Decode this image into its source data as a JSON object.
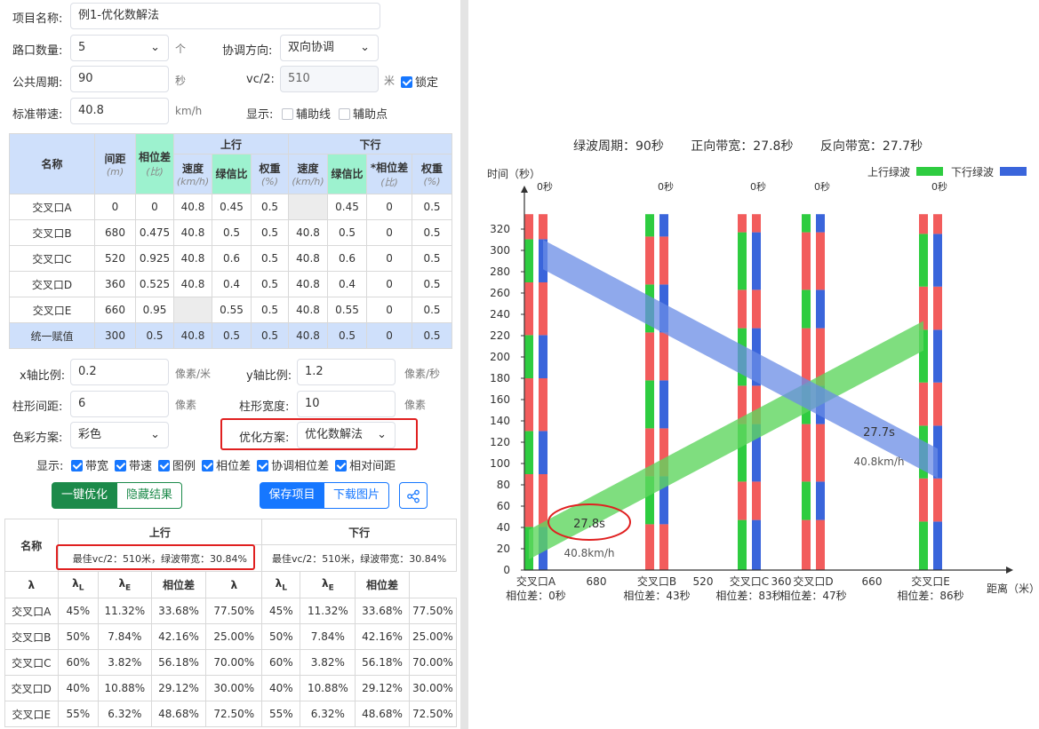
{
  "form": {
    "project_name_label": "项目名称:",
    "project_name": "例1-优化数解法",
    "intersections_label": "路口数量:",
    "intersections": "5",
    "intersections_unit": "个",
    "coord_dir_label": "协调方向:",
    "coord_dir": "双向协调",
    "cycle_label": "公共周期:",
    "cycle": "90",
    "cycle_unit": "秒",
    "vc2_label": "vc/2:",
    "vc2": "510",
    "vc2_unit": "米",
    "lock_label": "锁定",
    "speed_label": "标准带速:",
    "speed": "40.8",
    "speed_unit": "km/h",
    "display_label": "显示:",
    "aux_line": "辅助线",
    "aux_point": "辅助点"
  },
  "table1": {
    "h_name": "名称",
    "h_spacing": "间距",
    "h_spacing_unit": "(m)",
    "h_offset": "相位差",
    "h_offset_unit": "(比)",
    "h_up": "上行",
    "h_down": "下行",
    "h_speed": "速度",
    "h_speed_unit": "(km/h)",
    "h_green": "绿信比",
    "h_weight": "权重",
    "h_weight_unit": "(%)",
    "h_down_offset": "*相位差",
    "rows": [
      [
        "交叉口A",
        "0",
        "0",
        "40.8",
        "0.45",
        "0.5",
        "",
        "0.45",
        "0",
        "0.5"
      ],
      [
        "交叉口B",
        "680",
        "0.475",
        "40.8",
        "0.5",
        "0.5",
        "40.8",
        "0.5",
        "0",
        "0.5"
      ],
      [
        "交叉口C",
        "520",
        "0.925",
        "40.8",
        "0.6",
        "0.5",
        "40.8",
        "0.6",
        "0",
        "0.5"
      ],
      [
        "交叉口D",
        "360",
        "0.525",
        "40.8",
        "0.4",
        "0.5",
        "40.8",
        "0.4",
        "0",
        "0.5"
      ],
      [
        "交叉口E",
        "660",
        "0.95",
        "",
        "0.55",
        "0.5",
        "40.8",
        "0.55",
        "0",
        "0.5"
      ],
      [
        "统一赋值",
        "300",
        "0.5",
        "40.8",
        "0.5",
        "0.5",
        "40.8",
        "0.5",
        "0",
        "0.5"
      ]
    ]
  },
  "settings": {
    "xscale_label": "x轴比例:",
    "xscale": "0.2",
    "xscale_unit": "像素/米",
    "yscale_label": "y轴比例:",
    "yscale": "1.2",
    "yscale_unit": "像素/秒",
    "bar_gap_label": "柱形间距:",
    "bar_gap": "6",
    "bar_gap_unit": "像素",
    "bar_width_label": "柱形宽度:",
    "bar_width": "10",
    "bar_width_unit": "像素",
    "color_label": "色彩方案:",
    "color": "彩色",
    "opt_label": "优化方案:",
    "opt": "优化数解法",
    "show_label": "显示:",
    "show_opts": [
      "带宽",
      "带速",
      "图例",
      "相位差",
      "协调相位差",
      "相对间距"
    ]
  },
  "buttons": {
    "optimize": "一键优化",
    "hide": "隐藏结果",
    "save": "保存项目",
    "download": "下载图片"
  },
  "table2": {
    "h_name": "名称",
    "h_up": "上行",
    "h_down": "下行",
    "up_best": "最佳vc/2：510米，绿波带宽：30.84%",
    "down_best": "最佳vc/2：510米，绿波带宽：30.84%",
    "cols": [
      "λ",
      "λL",
      "λE",
      "相位差",
      "λ",
      "λL",
      "λE",
      "相位差"
    ],
    "rows": [
      [
        "交叉口A",
        "45%",
        "11.32%",
        "33.68%",
        "77.50%",
        "45%",
        "11.32%",
        "33.68%",
        "77.50%"
      ],
      [
        "交叉口B",
        "50%",
        "7.84%",
        "42.16%",
        "25.00%",
        "50%",
        "7.84%",
        "42.16%",
        "25.00%"
      ],
      [
        "交叉口C",
        "60%",
        "3.82%",
        "56.18%",
        "70.00%",
        "60%",
        "3.82%",
        "56.18%",
        "70.00%"
      ],
      [
        "交叉口D",
        "40%",
        "10.88%",
        "29.12%",
        "30.00%",
        "40%",
        "10.88%",
        "29.12%",
        "30.00%"
      ],
      [
        "交叉口E",
        "55%",
        "6.32%",
        "48.68%",
        "72.50%",
        "55%",
        "6.32%",
        "48.68%",
        "72.50%"
      ]
    ]
  },
  "chart": {
    "summary": [
      "绿波周期：90秒",
      "正向带宽：27.8秒",
      "反向带宽：27.7秒"
    ],
    "ylabel": "时间（秒）",
    "xlabel": "距离（米）",
    "legend_up": "上行绿波",
    "legend_down": "下行绿波",
    "colors": {
      "green": "#2ecc40",
      "red": "#f25c5c",
      "blue": "#3a65db",
      "band_up": "#5fd65f",
      "band_down": "#6a8ce6"
    },
    "up_band_label": "27.8s",
    "up_speed_label": "40.8km/h",
    "down_band_label": "27.7s",
    "down_speed_label": "40.8km/h"
  },
  "chart_data": {
    "type": "time-space diagram",
    "cycle": 90,
    "ylim": [
      0,
      330
    ],
    "yticks": [
      0,
      20,
      40,
      60,
      80,
      100,
      120,
      140,
      160,
      180,
      200,
      220,
      240,
      260,
      280,
      300,
      320
    ],
    "intersections": [
      {
        "name": "交叉口A",
        "pos": 0,
        "offset_label": "相位差：0秒",
        "top_label": "0秒",
        "split": 0.45,
        "offset": 0
      },
      {
        "name": "交叉口B",
        "pos": 680,
        "offset_label": "相位差：43秒",
        "top_label": "0秒",
        "split": 0.5,
        "offset": 43
      },
      {
        "name": "交叉口C",
        "pos": 1200,
        "offset_label": "相位差：83秒",
        "top_label": "0秒",
        "split": 0.6,
        "offset": 83
      },
      {
        "name": "交叉口D",
        "pos": 1560,
        "offset_label": "相位差：47秒",
        "top_label": "0秒",
        "split": 0.4,
        "offset": 47
      },
      {
        "name": "交叉口E",
        "pos": 2220,
        "offset_label": "相位差：86秒",
        "top_label": "0秒",
        "split": 0.55,
        "offset": 86
      }
    ],
    "segment_labels": [
      "680",
      "520",
      "360",
      "660"
    ],
    "up_band": {
      "start_low": 10,
      "start_high": 37.8,
      "end_low": 206,
      "end_high": 233.8
    },
    "down_band": {
      "start_low": 282.3,
      "start_high": 310,
      "end_low": 86.3,
      "end_high": 114
    }
  }
}
